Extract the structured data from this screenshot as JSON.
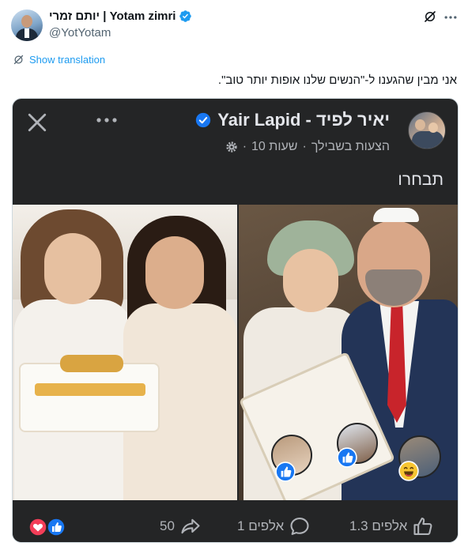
{
  "tweet": {
    "display_name": "יותם זמרי | Yotam zimri",
    "handle": "@YotYotam",
    "show_translation": "Show translation",
    "text": "אני מבין שהגענו ל-\"הנשים שלנו אופות יותר טוב\".",
    "icons": {
      "grok": "grok-icon",
      "more": "more-icon",
      "verified": "verified-badge-icon",
      "translate": "translate-icon"
    }
  },
  "fb_post": {
    "author": "Yair Lapid - יאיר לפיד",
    "meta_prefix": "הצעות בשבילך",
    "meta_time": "10 שעות",
    "text": "תבחרו",
    "icons": {
      "close": "close-icon",
      "options": "more-options-icon",
      "privacy": "gear-icon"
    },
    "stats": {
      "likes": "1.3 אלפים",
      "comments": "1 אלפים",
      "shares": "50"
    },
    "colors": {
      "background": "#242526",
      "text": "#e4e6eb",
      "muted": "#b0b3b8",
      "like_blue": "#1877f2",
      "love_red": "#f33e58"
    }
  }
}
